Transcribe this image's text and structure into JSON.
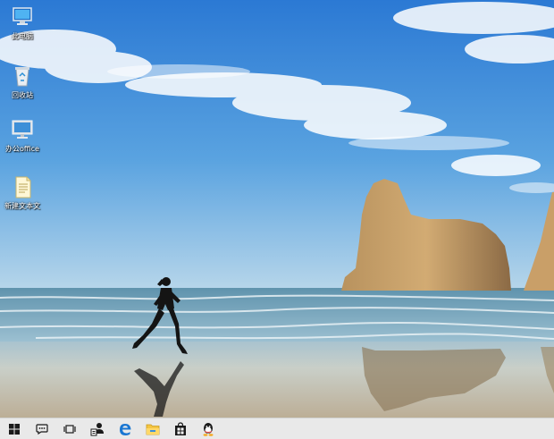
{
  "desktop": {
    "icons": [
      {
        "label": "此电脑",
        "icon": "computer-icon"
      },
      {
        "label": "回收站",
        "icon": "recycle-bin-icon"
      },
      {
        "label": "办公office",
        "icon": "office-monitor-icon"
      },
      {
        "label": "新建文本文",
        "icon": "text-document-icon"
      }
    ]
  },
  "taskbar": {
    "buttons": [
      {
        "icon": "windows-start-icon"
      },
      {
        "icon": "cortana-icon"
      },
      {
        "icon": "task-view-icon"
      },
      {
        "icon": "people-icon"
      },
      {
        "icon": "edge-icon"
      },
      {
        "icon": "file-explorer-icon"
      },
      {
        "icon": "store-icon"
      },
      {
        "icon": "qq-icon"
      }
    ]
  },
  "colors": {
    "sky_top": "#2f7ed8",
    "sky_bottom": "#a9cde8",
    "sea": "#6f9fb5",
    "sand": "#c4b9a4",
    "taskbar": "#e9e9e9",
    "accent": "#1976d2"
  }
}
